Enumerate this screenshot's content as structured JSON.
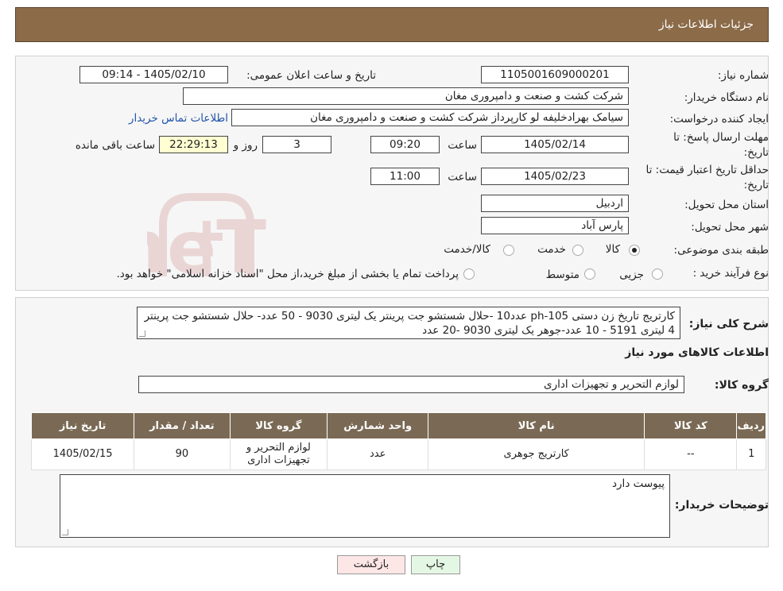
{
  "header": {
    "title": "جزئیات اطلاعات نیاز"
  },
  "form": {
    "need_number_label": "شماره نیاز:",
    "need_number": "1105001609000201",
    "announce_label": "تاریخ و ساعت اعلان عمومی:",
    "announce_value": "1405/02/10 - 09:14",
    "buyer_org_label": "نام دستگاه خریدار:",
    "buyer_org": "شرکت کشت و صنعت و دامپروری مغان",
    "requester_label": "ایجاد کننده درخواست:",
    "requester": "سیامک بهرادخلیفه لو کارپرداز شرکت کشت و صنعت و دامپروری مغان",
    "contact_link": "اطلاعات تماس خریدار",
    "deadline_label_1": "مهلت ارسال پاسخ: تا",
    "deadline_label_2": "تاریخ:",
    "deadline_date": "1405/02/14",
    "time_label": "ساعت",
    "deadline_time": "09:20",
    "days": "3",
    "days_label": "روز و",
    "remaining_time": "22:29:13",
    "remaining_label": "ساعت باقی مانده",
    "validity_label_1": "حداقل تاریخ اعتبار قیمت: تا",
    "validity_label_2": "تاریخ:",
    "validity_date": "1405/02/23",
    "validity_time": "11:00",
    "province_label": "استان محل تحویل:",
    "province": "اردبیل",
    "city_label": "شهر محل تحویل:",
    "city": "پارس آباد",
    "category_label": "طبقه بندی موضوعی:",
    "category_options": [
      "کالا",
      "خدمت",
      "کالا/خدمت"
    ],
    "category_selected": "کالا",
    "process_label": "نوع فرآیند خرید :",
    "process_options": [
      "جزیی",
      "متوسط"
    ],
    "process_note": "پرداخت تمام یا بخشی از مبلغ خرید،از محل \"اسناد خزانه اسلامی\" خواهد بود."
  },
  "summary": {
    "desc_label": "شرح کلی نیاز:",
    "desc_text": "کارتریج تاریخ زن دستی ph-105 عدد10 -حلال شستشو جت پرینتر یک لیتری 9030 - 50 عدد- حلال شستشو جت پرینتر 4 لیتری 5191 - 10 عدد-جوهر یک لیتری 9030 -20 عدد",
    "goods_info_title": "اطلاعات کالاهای مورد نیاز",
    "goods_group_label": "گروه کالا:",
    "goods_group": "لوازم التحریر و تجهیزات اداری",
    "table_headers": [
      "ردیف",
      "کد کالا",
      "نام کالا",
      "واحد شمارش",
      "گروه کالا",
      "تعداد / مقدار",
      "تاریخ نیاز"
    ],
    "rows": [
      [
        "1",
        "--",
        "کارتریج جوهری",
        "عدد",
        "لوازم التحریر و تجهیزات اداری",
        "90",
        "1405/02/15"
      ]
    ],
    "buyer_notes_label": "توضیحات خریدار:",
    "buyer_notes": "پیوست دارد"
  },
  "buttons": {
    "print": "چاپ",
    "back": "بازگشت"
  },
  "watermark": {
    "text": "AriaTender.neT",
    "color": "#b03030"
  }
}
